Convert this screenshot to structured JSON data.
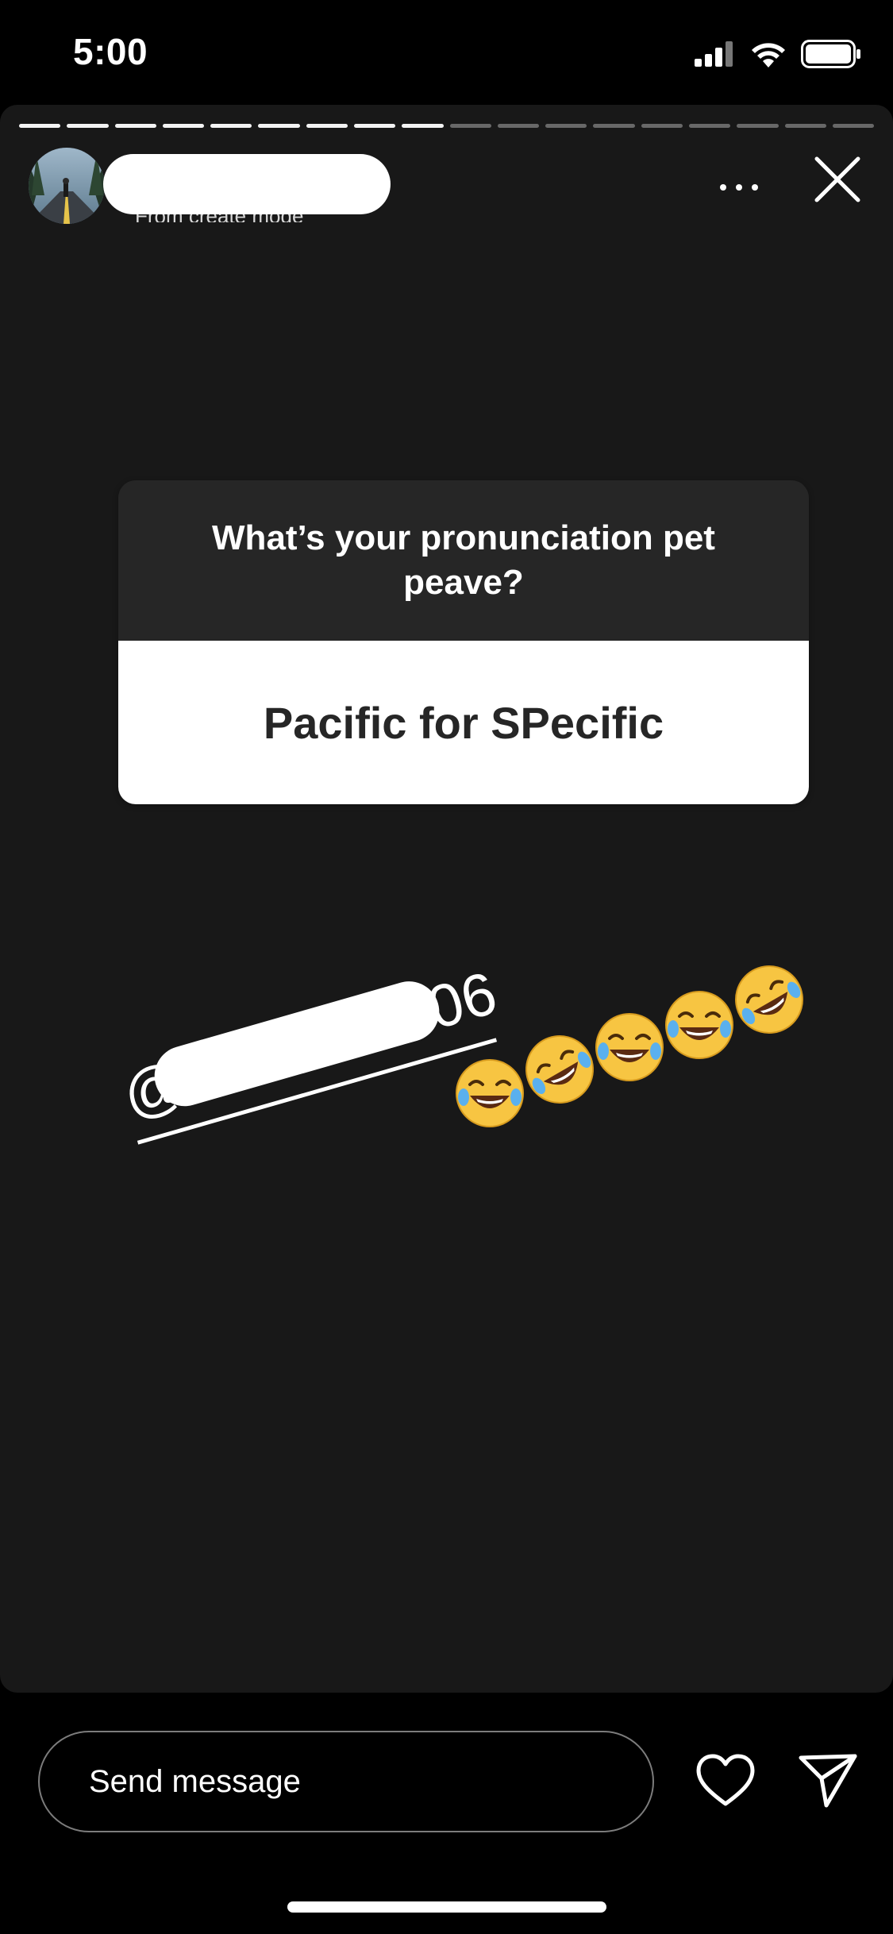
{
  "status_bar": {
    "time": "5:00",
    "icons": [
      "cellular-signal-icon",
      "wifi-icon",
      "battery-icon"
    ]
  },
  "story": {
    "progress": {
      "total_segments": 18,
      "completed_segments": 9
    },
    "header": {
      "username": "",
      "subtitle": "From create mode"
    },
    "question_sticker": {
      "question": "What’s your pronunciation pet peave?",
      "answer": "Pacific for SPecific"
    },
    "mention_sticker": {
      "prefix": "@",
      "suffix": "06",
      "emojis": [
        "face-with-tears-of-joy",
        "rolling-on-the-floor-laughing",
        "face-with-tears-of-joy",
        "face-with-tears-of-joy",
        "rolling-on-the-floor-laughing"
      ]
    }
  },
  "composer": {
    "placeholder": "Send message"
  },
  "colors": {
    "story_bg": "#181818",
    "question_bg": "#262626",
    "answer_bg": "#ffffff",
    "emoji_yellow": "#f7c542"
  }
}
